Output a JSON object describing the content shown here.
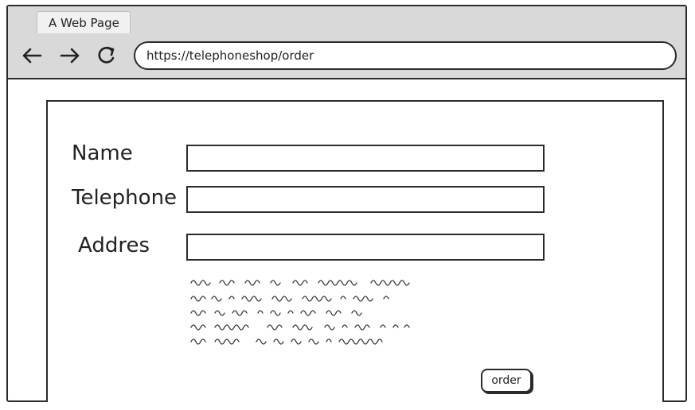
{
  "browser": {
    "tab_title": "A Web Page",
    "url": "https://telephoneshop/order",
    "icons": {
      "back": "arrow-left-icon",
      "forward": "arrow-right-icon",
      "reload": "reload-icon"
    }
  },
  "form": {
    "name_label": "Name",
    "telephone_label": "Telephone",
    "address_label": "Addres",
    "name_value": "",
    "telephone_value": "",
    "address_value": "",
    "order_button": "order"
  }
}
